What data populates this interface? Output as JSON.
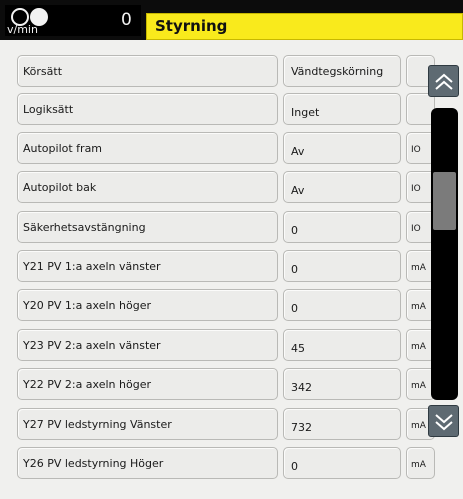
{
  "header": {
    "rpm_unit": "v/min",
    "rpm_value": "0",
    "title": "Styrning"
  },
  "rows": [
    {
      "label": "Körsätt",
      "value": "Vändtegskörning",
      "unit": ""
    },
    {
      "label": "Logiksätt",
      "value": "Inget",
      "unit": ""
    },
    {
      "label": "Autopilot fram",
      "value": "Av",
      "unit": "IO"
    },
    {
      "label": "Autopilot bak",
      "value": "Av",
      "unit": "IO"
    },
    {
      "label": "Säkerhetsavstängning",
      "value": "0",
      "unit": "IO"
    },
    {
      "label": "Y21 PV 1:a axeln vänster",
      "value": "0",
      "unit": "mA"
    },
    {
      "label": "Y20 PV 1:a axeln höger",
      "value": "0",
      "unit": "mA"
    },
    {
      "label": "Y23 PV 2:a axeln vänster",
      "value": "45",
      "unit": "mA"
    },
    {
      "label": "Y22 PV 2:a axeln höger",
      "value": "342",
      "unit": "mA"
    },
    {
      "label": "Y27 PV ledstyrning Vänster",
      "value": "732",
      "unit": "mA"
    },
    {
      "label": "Y26 PV ledstyrning Höger",
      "value": "0",
      "unit": "mA"
    }
  ],
  "scroll": {
    "up_icon": "double-chevron-up-icon",
    "down_icon": "double-chevron-down-icon",
    "position": 0.27
  },
  "colors": {
    "title_bar": "#f9ea1c",
    "top_bar": "#0c0c0c",
    "scroll_button": "#5e6a72"
  }
}
